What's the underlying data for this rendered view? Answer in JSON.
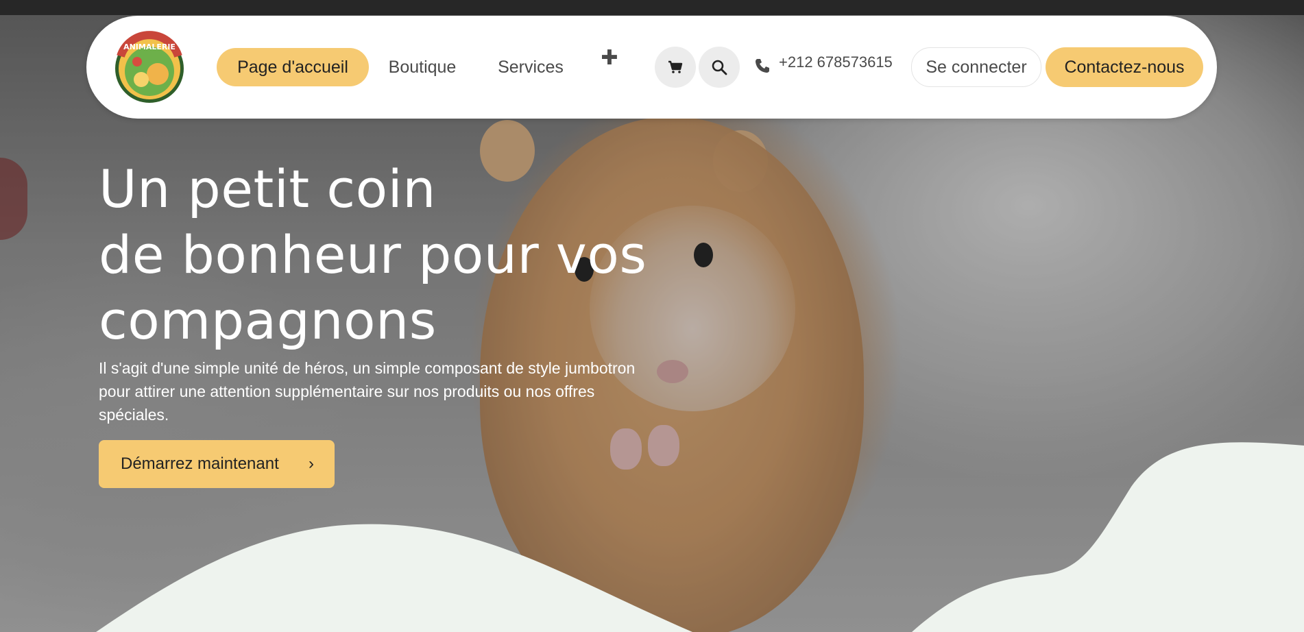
{
  "nav": {
    "logo_text": "ANIMALERIE",
    "items": [
      {
        "label": "Page d'accueil",
        "active": true
      },
      {
        "label": "Boutique",
        "active": false
      },
      {
        "label": "Services",
        "active": false
      }
    ],
    "plus_symbol": "✚",
    "cart_icon": "cart-icon",
    "search_icon": "search-icon",
    "phone": "+212 678573615",
    "login_label": "Se connecter",
    "contact_label": "Contactez-nous"
  },
  "hero": {
    "headline_lines": [
      "Un petit coin",
      "de bonheur pour vos",
      "compagnons"
    ],
    "lead": "Il s'agit d'une simple unité de héros, un simple composant de style jumbotron pour attirer une attention supplémentaire sur nos produits ou nos offres spéciales.",
    "cta_label": "Démarrez maintenant",
    "cta_arrow": "›"
  },
  "colors": {
    "accent": "#f6ca72",
    "nav_bg": "#ffffff",
    "wave": "#eef3ee",
    "text_dark": "#222222",
    "text_nav": "#4a4a4a"
  }
}
